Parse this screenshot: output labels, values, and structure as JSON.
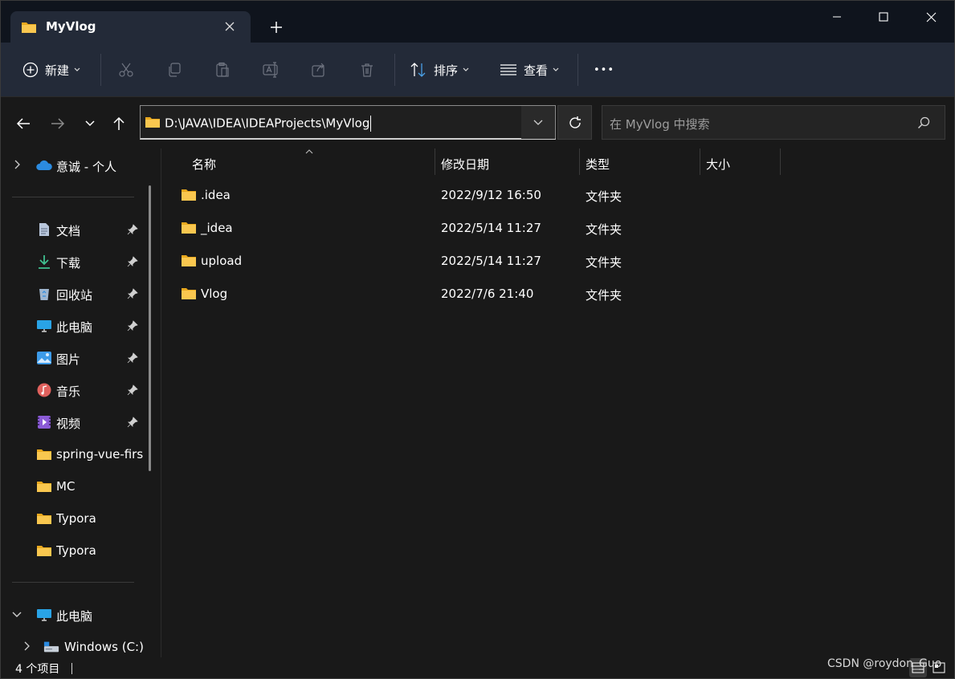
{
  "tab": {
    "title": "MyVlog"
  },
  "toolbar": {
    "new_label": "新建",
    "sort_label": "排序",
    "view_label": "查看",
    "more_label": "•••"
  },
  "address": {
    "path": "D:\\JAVA\\IDEA\\IDEAProjects\\MyVlog"
  },
  "search": {
    "placeholder": "在 MyVlog 中搜索"
  },
  "sidebar": {
    "onedrive": "意诚 - 个人",
    "quick_access": [
      {
        "label": "文档",
        "icon": "documents-icon"
      },
      {
        "label": "下载",
        "icon": "download-icon"
      },
      {
        "label": "回收站",
        "icon": "recycle-bin-icon"
      },
      {
        "label": "此电脑",
        "icon": "this-pc-icon"
      },
      {
        "label": "图片",
        "icon": "pictures-icon"
      },
      {
        "label": "音乐",
        "icon": "music-icon"
      },
      {
        "label": "视频",
        "icon": "videos-icon"
      },
      {
        "label": "spring-vue-firs",
        "icon": "folder-icon"
      },
      {
        "label": "MC",
        "icon": "folder-icon"
      },
      {
        "label": "Typora",
        "icon": "folder-icon"
      },
      {
        "label": "Typora",
        "icon": "folder-icon"
      }
    ],
    "this_pc": "此电脑",
    "drive_c": "Windows (C:)"
  },
  "columns": {
    "name": "名称",
    "date": "修改日期",
    "type": "类型",
    "size": "大小"
  },
  "files": [
    {
      "name": ".idea",
      "date": "2022/9/12 16:50",
      "type": "文件夹"
    },
    {
      "name": "_idea",
      "date": "2022/5/14 11:27",
      "type": "文件夹"
    },
    {
      "name": "upload",
      "date": "2022/5/14 11:27",
      "type": "文件夹"
    },
    {
      "name": "Vlog",
      "date": "2022/7/6 21:40",
      "type": "文件夹"
    }
  ],
  "status": {
    "item_count": "4 个项目"
  },
  "watermark": "CSDN @roydon_Guo",
  "colors": {
    "folder": "#f9c74f",
    "accent": "#4aa0e6",
    "titlebar": "#0f141d",
    "commandbar": "#232a38"
  }
}
